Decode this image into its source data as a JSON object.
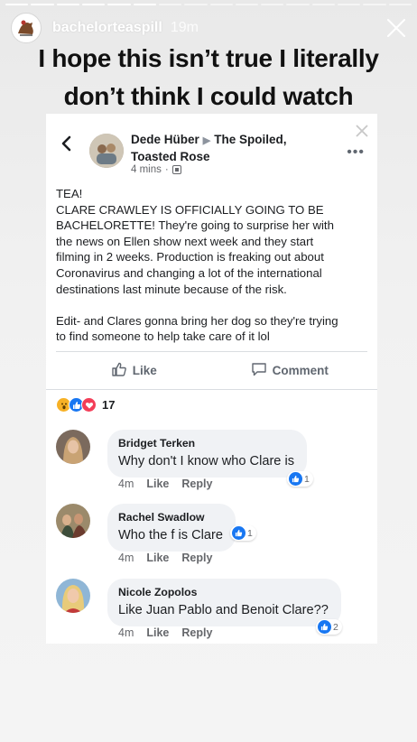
{
  "story": {
    "username": "bachelorteaspill",
    "time": "19m",
    "progress_total": 16,
    "progress_done": 6
  },
  "caption": {
    "line1": "I hope this isn’t true I literally",
    "line2": "don’t think I could watch"
  },
  "post": {
    "author": "Dede Hüber",
    "group": "The Spoiled, Toasted Rose",
    "time": "4 mins",
    "body_lines": [
      "TEA!",
      "CLARE CRAWLEY IS OFFICIALLY GOING TO BE",
      "BACHELORETTE! They're going to surprise her with",
      "the news on Ellen show next week and they start",
      "filming in 2 weeks. Production is freaking out about",
      "Coronavirus and changing a lot of the international",
      "destinations last minute because of the risk."
    ],
    "edit_lines": [
      "Edit- and Clares gonna bring her dog so they're trying",
      "to find someone to help take care of it lol"
    ],
    "like_label": "Like",
    "comment_label": "Comment",
    "reaction_count": "17"
  },
  "comments": [
    {
      "name": "Bridget Terken",
      "text": "Why don't I know who Clare is",
      "time": "4m",
      "like": "Like",
      "reply": "Reply",
      "reactions": "1"
    },
    {
      "name": "Rachel Swadlow",
      "text": "Who the f is Clare",
      "time": "4m",
      "like": "Like",
      "reply": "Reply",
      "reactions": "1"
    },
    {
      "name": "Nicole Zopolos",
      "text": "Like Juan Pablo and Benoit Clare??",
      "time": "4m",
      "like": "Like",
      "reply": "Reply",
      "reactions": "2"
    }
  ],
  "colors": {
    "fb_blue": "#1877f2",
    "love_red": "#f33e58",
    "wow_yellow": "#f7b125",
    "bubble_bg": "#f0f2f5"
  },
  "icons": [
    "story-avatar-icon",
    "close-icon",
    "back-chevron-icon",
    "more-dots-icon",
    "like-thumb-icon",
    "comment-icon",
    "wow-reaction-icon",
    "like-reaction-icon",
    "love-reaction-icon"
  ]
}
